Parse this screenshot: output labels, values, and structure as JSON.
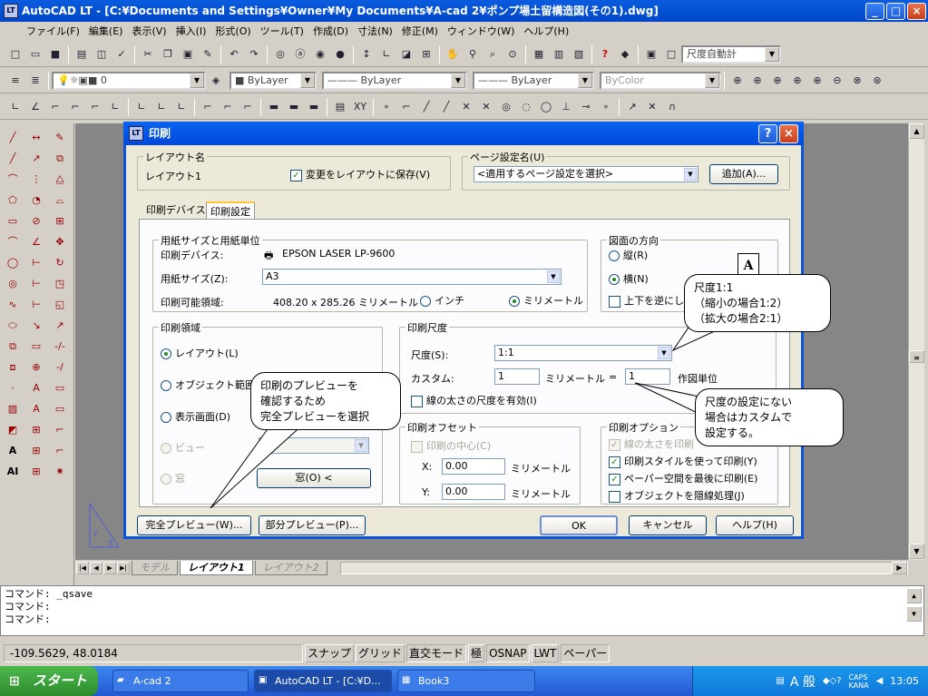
{
  "window": {
    "title": "AutoCAD LT - [C:¥Documents and Settings¥Owner¥My Documents¥A-cad 2¥ポンプ場土留構造図(その1).dwg]",
    "icon": "autocad-icon",
    "min": "_",
    "max": "□",
    "close": "×"
  },
  "menu": [
    "ファイル(F)",
    "編集(E)",
    "表示(V)",
    "挿入(I)",
    "形式(O)",
    "ツール(T)",
    "作成(D)",
    "寸法(N)",
    "修正(M)",
    "ウィンドウ(W)",
    "ヘルプ(H)"
  ],
  "toolbar": {
    "layer": "0",
    "color": "ByLayer",
    "linetype": "ByLayer",
    "lineweight": "ByLayer",
    "plotstyle": "ByColor",
    "dimstyle": "尺度自動計"
  },
  "dialog": {
    "title": "印刷",
    "help": "?",
    "close": "×",
    "layout_name": {
      "group": "レイアウト名",
      "name": "レイアウト1",
      "save_label": "変更をレイアウトに保存(V)",
      "save_checked": "✓"
    },
    "page_setup": {
      "group": "ページ設定名(U)",
      "value": "<適用するページ設定を選択>",
      "add_button": "追加(A)..."
    },
    "tabs": [
      "印刷デバイス",
      "印刷設定"
    ],
    "paper": {
      "group": "用紙サイズと用紙単位",
      "device_label": "印刷デバイス:",
      "device_value": "EPSON LASER LP-9600",
      "size_label": "用紙サイズ(Z):",
      "size_value": "A3",
      "area_label": "印刷可能領域:",
      "area_value": "408.20 x 285.26 ミリメートル",
      "inch": "インチ",
      "mm": "ミリメートル"
    },
    "orientation": {
      "group": "図面の方向",
      "portrait": "縦(R)",
      "landscape": "横(N)",
      "upside": "上下を逆にして",
      "icon_letter": "A"
    },
    "plot_area": {
      "group": "印刷領域",
      "layout": "レイアウト(L)",
      "extents": "オブジェクト範囲(X)",
      "display": "表示画面(D)",
      "view": "ビュー",
      "window": "窓",
      "window_button": "窓(O) <"
    },
    "scale": {
      "group": "印刷尺度",
      "scale_label": "尺度(S):",
      "scale_value": "1:1",
      "custom_label": "カスタム:",
      "custom_left": "1",
      "unit": "ミリメートル",
      "equals": "=",
      "custom_right": "1",
      "drawing_units": "作図単位",
      "lineweight": "線の太さの尺度を有効(I)"
    },
    "offset": {
      "group": "印刷オフセット",
      "center": "印刷の中心(C)",
      "x_label": "X:",
      "x_value": "0.00",
      "y_label": "Y:",
      "y_value": "0.00",
      "unit": "ミリメートル"
    },
    "options": {
      "group": "印刷オプション",
      "lw": "線の太さを印刷",
      "style": "印刷スタイルを使って印刷(Y)",
      "paperspace": "ペーパー空間を最後に印刷(E)",
      "hide": "オブジェクトを隠線処理(J)",
      "check": "✓"
    },
    "buttons": {
      "full_preview": "完全プレビュー(W)...",
      "partial_preview": "部分プレビュー(P)...",
      "ok": "OK",
      "cancel": "キャンセル",
      "help": "ヘルプ(H)"
    }
  },
  "callouts": {
    "scale": [
      "尺度1:1",
      "（縮小の場合1:2）",
      "（拡大の場合2:1）"
    ],
    "preview": [
      "印刷のプレビューを",
      "確認するため",
      "完全プレビューを選択"
    ],
    "custom": [
      "尺度の設定にない",
      "場合はカスタムで",
      "設定する。"
    ]
  },
  "layout_tabs": [
    "モデル",
    "レイアウト1",
    "レイアウト2"
  ],
  "command_lines": [
    "コマンド: _qsave",
    "コマンド:",
    "コマンド:"
  ],
  "status": {
    "coords": "-109.5629, 48.0184",
    "items": [
      "スナップ",
      "グリッド",
      "直交モード",
      "極",
      "OSNAP",
      "LWT",
      "ペーパー"
    ]
  },
  "taskbar": {
    "start": "スタート",
    "tasks": [
      {
        "label": "A-cad 2",
        "icon": "folder-icon"
      },
      {
        "label": "AutoCAD LT - [C:¥D...",
        "icon": "autocad-icon"
      },
      {
        "label": "Book3",
        "icon": "excel-icon"
      }
    ],
    "ime": "A 般",
    "caps": "CAPS",
    "kana": "KANA",
    "time": "13:05"
  }
}
